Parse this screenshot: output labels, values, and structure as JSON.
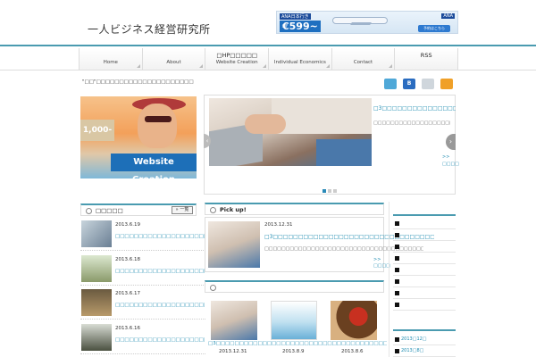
{
  "header": {
    "logo": "一人ビジネス経営研究所",
    "ad": {
      "brand_left": "ANA日本行き",
      "price": "€599~",
      "brand_right": "ANA",
      "button": "予約はこちら"
    }
  },
  "nav": {
    "items": [
      {
        "label": "Home",
        "top": ""
      },
      {
        "label": "About",
        "top": ""
      },
      {
        "label": "Website Creation",
        "top": "□HP□□□□□"
      },
      {
        "label": "Individual Economics",
        "top": ""
      },
      {
        "label": "Contact",
        "top": ""
      },
      {
        "label": "",
        "top": "RSS"
      }
    ]
  },
  "tagline": "\"□□\"□□□□□□□□□□□□□□□□□□□□□",
  "social": {
    "icons": [
      "bird-icon",
      "hatena-icon",
      "feed-icon",
      "rss-icon"
    ],
    "labels": [
      "",
      "B",
      "",
      ""
    ]
  },
  "hero": {
    "sign": "1,000-",
    "band": "Website Creation"
  },
  "slider": {
    "title": "□3□□□□□□□□□□□□□□□□□□□□□□□□□",
    "desc": "□□□□□□□□□□□□□□□□□□□□□□□□□□□□□□□□",
    "more": ">>",
    "more2": "□□□□",
    "prev": "‹",
    "next": "›",
    "dots": 3,
    "active_dot": 0
  },
  "news": {
    "title": "□□□□□",
    "all_button": "» 一覧",
    "items": [
      {
        "date": "2013.6.19",
        "title": "□□□□□□□□□□□□□□□□□□□□□□□□□□"
      },
      {
        "date": "2013.6.18",
        "title": "□□□□□□□□□□□□□□□□□□□□□□□□□□□□□□□□□□□"
      },
      {
        "date": "2013.6.17",
        "title": "□□□□□□□□□□□□□□□□□□□□□□□□□□□□□□□□□□□□□□□"
      },
      {
        "date": "2013.6.16",
        "title": "□□□□□□□□□□□□□□□□□□□□□□□□□□□□□□□□□□"
      }
    ]
  },
  "pickup": {
    "title": "Pick up!",
    "date": "2013.12.31",
    "headline": "□3□□□□□□□□□□□□□□□□□□□□□□□□□□□□□□□□□□□□□□□□□□□□□□□□",
    "desc": "□□□□□□□□□□□□□□□□□□□□□□□□□□□□□□□□□□□□□□□□□□□□□□□□□□□...",
    "more": ">>",
    "more2": "□□□□"
  },
  "gallery": {
    "title": "",
    "caption": "□3□□□□□□□□□□□□□□□□□□□□□□□□□□□□□□□□□□□□□□□□□□□□□□□",
    "dates": [
      "2013.12.31",
      "2013.8.9",
      "2013.8.6"
    ]
  },
  "sidebar": {
    "items": [
      "",
      "",
      "",
      "",
      "",
      "",
      "",
      "",
      ""
    ],
    "archive": [
      "2013□12□",
      "2013□8□"
    ]
  }
}
